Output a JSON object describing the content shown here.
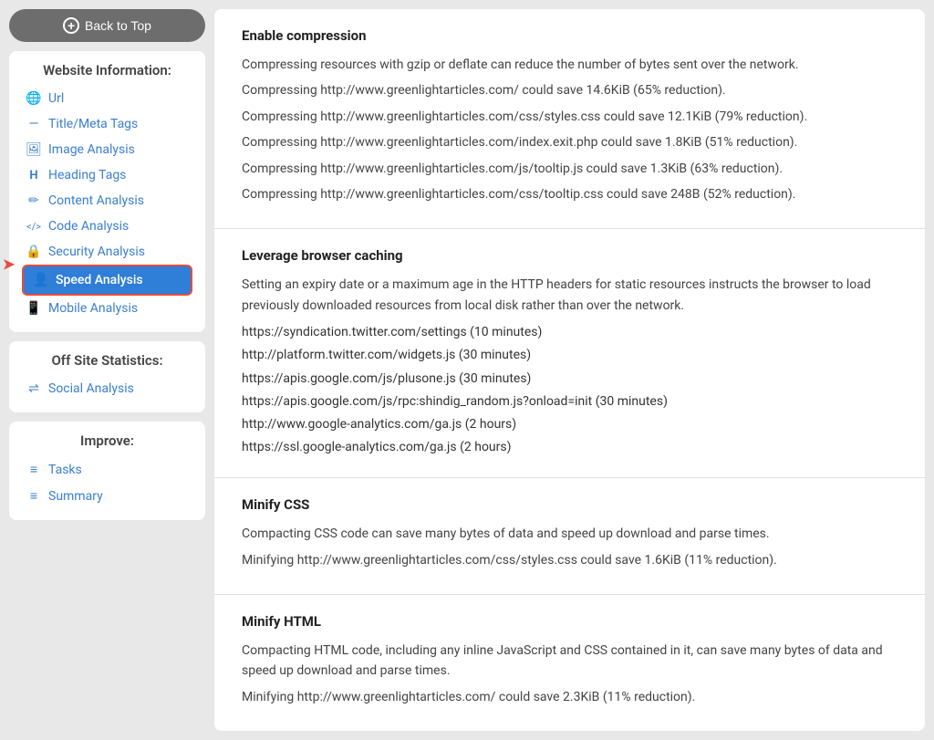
{
  "sidebar": {
    "back_to_top": "Back to Top",
    "website_info_title": "Website Information:",
    "nav_items": [
      {
        "id": "url",
        "label": "Url",
        "icon": "🌐"
      },
      {
        "id": "title-meta",
        "label": "Title/Meta Tags",
        "icon": "—"
      },
      {
        "id": "image-analysis",
        "label": "Image Analysis",
        "icon": "🖼"
      },
      {
        "id": "heading-tags",
        "label": "Heading Tags",
        "icon": "H"
      },
      {
        "id": "content-analysis",
        "label": "Content Analysis",
        "icon": "✏"
      },
      {
        "id": "code-analysis",
        "label": "Code Analysis",
        "icon": "</>"
      },
      {
        "id": "security-analysis",
        "label": "Security Analysis",
        "icon": "🔒"
      },
      {
        "id": "speed-analysis",
        "label": "Speed Analysis",
        "icon": "👤",
        "active": true
      },
      {
        "id": "mobile-analysis",
        "label": "Mobile Analysis",
        "icon": "📱"
      }
    ],
    "offsite_title": "Off Site Statistics:",
    "offsite_items": [
      {
        "id": "social-analysis",
        "label": "Social Analysis",
        "icon": "⇌"
      }
    ],
    "improve_title": "Improve:",
    "improve_items": [
      {
        "id": "tasks",
        "label": "Tasks",
        "icon": "≡"
      },
      {
        "id": "summary",
        "label": "Summary",
        "icon": "≡"
      }
    ]
  },
  "content": {
    "sections": [
      {
        "id": "enable-compression",
        "title": "Enable compression",
        "paragraphs": [
          "Compressing resources with gzip or deflate can reduce the number of bytes sent over the network.",
          "Compressing http://www.greenlightarticles.com/ could save 14.6KiB (65% reduction).",
          "Compressing http://www.greenlightarticles.com/css/styles.css could save 12.1KiB (79% reduction).",
          "Compressing http://www.greenlightarticles.com/index.exit.php could save 1.8KiB (51% reduction).",
          "Compressing http://www.greenlightarticles.com/js/tooltip.js could save 1.3KiB (63% reduction).",
          "Compressing http://www.greenlightarticles.com/css/tooltip.css could save 248B (52% reduction)."
        ]
      },
      {
        "id": "leverage-browser-caching",
        "title": "Leverage browser caching",
        "paragraphs": [
          "Setting an expiry date or a maximum age in the HTTP headers for static resources instructs the browser to load previously downloaded resources from local disk rather than over the network.",
          "https://syndication.twitter.com/settings (10 minutes)",
          "http://platform.twitter.com/widgets.js (30 minutes)",
          "https://apis.google.com/js/plusone.js (30 minutes)",
          "https://apis.google.com/js/rpc:shindig_random.js?onload=init (30 minutes)",
          "http://www.google-analytics.com/ga.js (2 hours)",
          "https://ssl.google-analytics.com/ga.js (2 hours)"
        ]
      },
      {
        "id": "minify-css",
        "title": "Minify CSS",
        "paragraphs": [
          "Compacting CSS code can save many bytes of data and speed up download and parse times.",
          "Minifying http://www.greenlightarticles.com/css/styles.css could save 1.6KiB (11% reduction)."
        ]
      },
      {
        "id": "minify-html",
        "title": "Minify HTML",
        "paragraphs": [
          "Compacting HTML code, including any inline JavaScript and CSS contained in it, can save many bytes of data and speed up download and parse times.",
          "Minifying http://www.greenlightarticles.com/ could save 2.3KiB (11% reduction)."
        ]
      }
    ]
  }
}
